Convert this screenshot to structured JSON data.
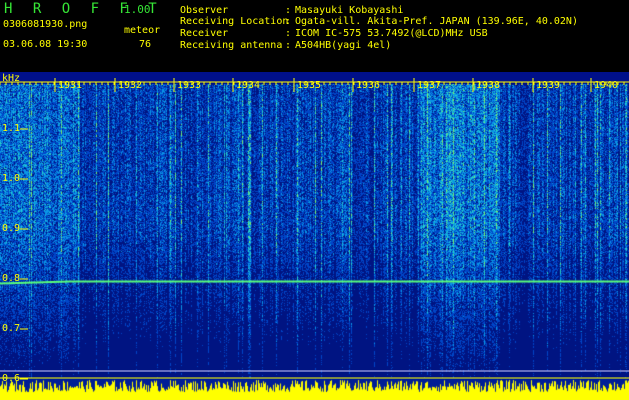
{
  "app": {
    "name": "H R O F F T",
    "version": "1.00"
  },
  "file": {
    "name": "0306081930.png",
    "datetime": "03.06.08 19:30"
  },
  "meteor": {
    "label": "meteor",
    "count": "76"
  },
  "info": [
    {
      "key": "Observer",
      "value": "Masayuki Kobayashi"
    },
    {
      "key": "Receiving Location",
      "value": "Ogata-vill. Akita-Pref. JAPAN (139.96E, 40.02N)"
    },
    {
      "key": "Receiver",
      "value": "ICOM IC-575 53.7492(@LCD)MHz USB"
    },
    {
      "key": "Receiving antenna",
      "value": "A504HB(yagi 4el)"
    }
  ],
  "spectrogram": {
    "unit": "kHz",
    "y_ticks": [
      "1.1",
      "1.0",
      "0.9",
      "0.8",
      "0.7",
      "0.6"
    ],
    "time_labels": [
      "1931",
      "1932",
      "1933",
      "1934",
      "1935",
      "1936",
      "1937",
      "1938",
      "1939",
      "1940"
    ],
    "carrier_khz": 0.795,
    "colors": {
      "background": "#00108a",
      "grid": "#ffff00",
      "carrier": "#5aff7a",
      "level_bars": "#ffff00"
    }
  }
}
